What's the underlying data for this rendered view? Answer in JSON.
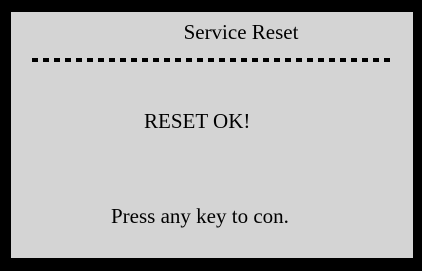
{
  "screen": {
    "title": "Service Reset",
    "status": "RESET OK!",
    "prompt": "Press any key to con."
  },
  "colors": {
    "display_background": "#d4d4d4",
    "bezel": "#000000",
    "text": "#000000"
  }
}
